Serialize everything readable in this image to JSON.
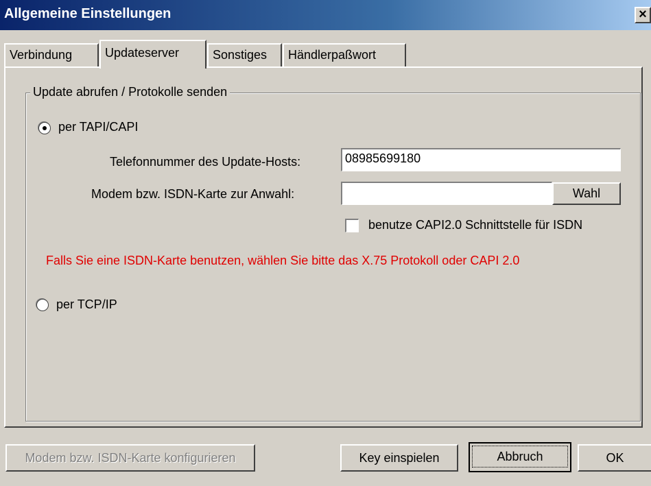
{
  "window": {
    "title": "Allgemeine Einstellungen",
    "close_symbol": "×"
  },
  "tabs": [
    {
      "label": "Verbindung",
      "selected": false
    },
    {
      "label": "Updateserver",
      "selected": true
    },
    {
      "label": "Sonstiges",
      "selected": false
    },
    {
      "label": "Händlerpaßwort",
      "selected": false
    }
  ],
  "group": {
    "legend": "Update abrufen / Protokolle senden",
    "radio_tapi": {
      "label": "per TAPI/CAPI",
      "checked": true
    },
    "phone": {
      "label": "Telefonnummer des Update-Hosts:",
      "value": "08985699180"
    },
    "modem": {
      "label": "Modem bzw. ISDN-Karte zur Anwahl:",
      "value": "",
      "button": "Wahl"
    },
    "capi_checkbox": {
      "label": "benutze CAPI2.0 Schnittstelle für ISDN",
      "checked": false
    },
    "warning": "Falls Sie eine ISDN-Karte benutzen, wählen Sie bitte das X.75 Protokoll oder CAPI 2.0",
    "radio_tcp": {
      "label": "per TCP/IP",
      "checked": false
    }
  },
  "buttons": {
    "configure": "Modem bzw. ISDN-Karte konfigurieren",
    "key": "Key einspielen",
    "cancel": "Abbruch",
    "ok": "OK"
  },
  "colors": {
    "warning": "#e00000",
    "titlebar": "#0a246a"
  }
}
